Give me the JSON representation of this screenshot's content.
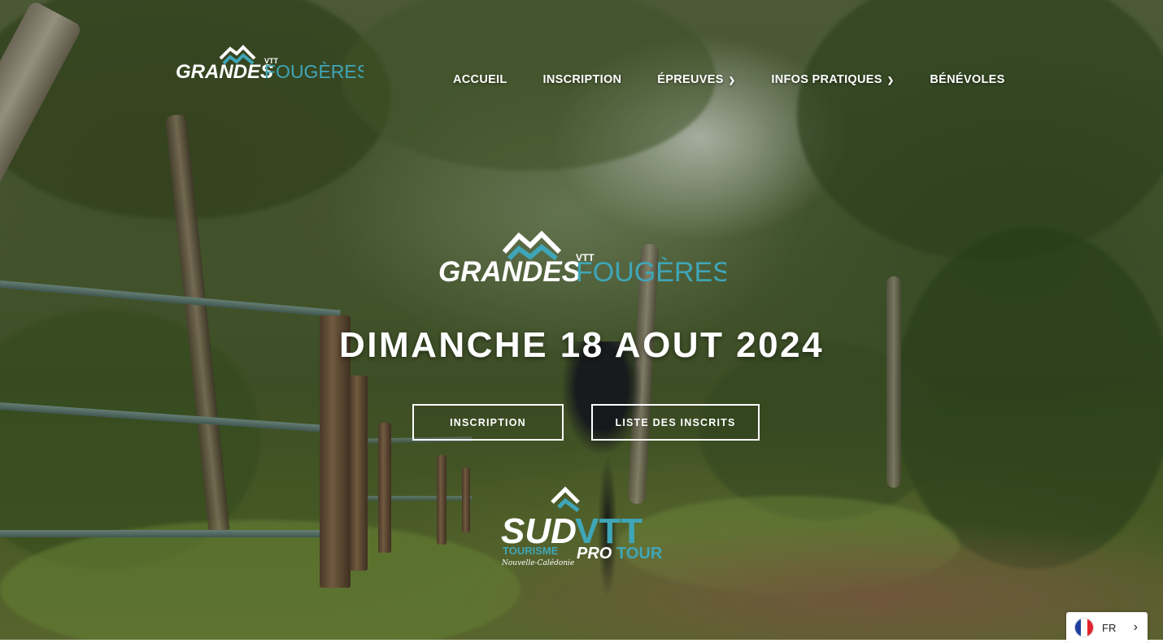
{
  "header": {
    "logo": {
      "word1": "GRANDES",
      "word2": "FOUGÈRES",
      "tag": "VTT"
    },
    "nav": [
      {
        "label": "ACCUEIL",
        "has_dropdown": false
      },
      {
        "label": "INSCRIPTION",
        "has_dropdown": false
      },
      {
        "label": "ÉPREUVES",
        "has_dropdown": true
      },
      {
        "label": "INFOS PRATIQUES",
        "has_dropdown": true
      },
      {
        "label": "BÉNÉVOLES",
        "has_dropdown": false
      }
    ]
  },
  "hero": {
    "logo": {
      "word1": "GRANDES",
      "word2": "FOUGÈRES",
      "tag": "VTT"
    },
    "date": "DIMANCHE 18 AOUT 2024",
    "buttons": {
      "primary": "INSCRIPTION",
      "secondary": "LISTE DES INSCRITS"
    },
    "partner_logo": {
      "word1": "SUD",
      "word2": "VTT",
      "line2a": "TOURISME",
      "line2b": "PRO",
      "line2c": "TOUR",
      "script": "Nouvelle-Calédonie"
    }
  },
  "language_switcher": {
    "code": "FR",
    "icon": "france-flag-icon"
  },
  "colors": {
    "accent_teal": "#3fa6b8",
    "text": "#ffffff"
  }
}
